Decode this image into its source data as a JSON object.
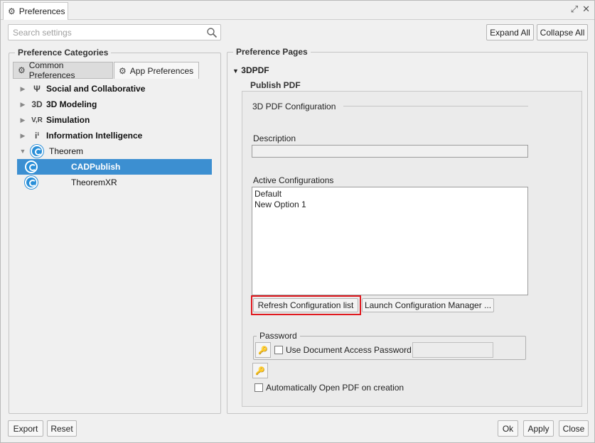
{
  "window": {
    "title": "Preferences",
    "controls": [
      "maximize-icon",
      "close-icon"
    ]
  },
  "search": {
    "placeholder": "Search settings"
  },
  "toolbar": {
    "expand_all": "Expand All",
    "collapse_all": "Collapse All"
  },
  "left": {
    "group_title": "Preference Categories",
    "tabs": [
      {
        "label": "Common Preferences",
        "active": false
      },
      {
        "label": "App Preferences",
        "active": true
      }
    ],
    "tree": [
      {
        "label": "Social and Collaborative",
        "icon": "collab-icon",
        "glyph": "Ψ",
        "expanded": false
      },
      {
        "label": "3D Modeling",
        "icon": "3d-icon",
        "glyph": "3D",
        "expanded": false
      },
      {
        "label": "Simulation",
        "icon": "simulation-icon",
        "glyph": "V,R",
        "expanded": false
      },
      {
        "label": "Information Intelligence",
        "icon": "info-intel-icon",
        "glyph": "iⁱ",
        "expanded": false
      },
      {
        "label": "Theorem",
        "icon": "theorem-icon",
        "expanded": true
      },
      {
        "label": "CADPublish",
        "icon": "theorem-icon",
        "selected": true
      },
      {
        "label": "TheoremXR",
        "icon": "theorem-icon"
      }
    ]
  },
  "right": {
    "group_title": "Preference Pages",
    "section": "3DPDF",
    "subgroup": "Publish PDF",
    "config_heading": "3D PDF Configuration",
    "description_label": "Description",
    "description_value": "",
    "active_label": "Active Configurations",
    "configs": [
      "Default",
      "New Option 1"
    ],
    "refresh_btn": "Refresh Configuration list",
    "launch_btn": "Launch Configuration Manager ...",
    "password_group": "Password",
    "use_password_label": "Use Document Access Password",
    "password_value": "",
    "auto_open_label": "Automatically Open PDF on creation"
  },
  "bottom": {
    "export": "Export",
    "reset": "Reset",
    "ok": "Ok",
    "apply": "Apply",
    "close": "Close"
  },
  "colors": {
    "selection": "#3c8fd1",
    "highlight": "#e0191f",
    "theorem_blue": "#2a8fd8"
  }
}
